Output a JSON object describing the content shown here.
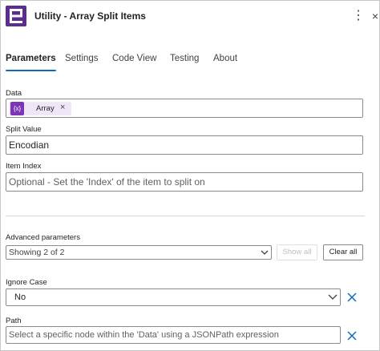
{
  "header": {
    "title": "Utility - Array Split Items",
    "logo_icon": "encodian-logo-icon",
    "more_icon": "more-vertical-icon",
    "close_icon": "close-icon",
    "more_glyph": "⋮",
    "close_glyph": "×"
  },
  "tabs": [
    "Parameters",
    "Settings",
    "Code View",
    "Testing",
    "About"
  ],
  "active_tab": "Parameters",
  "fields": {
    "data": {
      "label": "Data",
      "token": {
        "icon": "{x}",
        "label": "Array",
        "remove": "×"
      }
    },
    "split_value": {
      "label": "Split Value",
      "value": "Encodian"
    },
    "item_index": {
      "label": "Item Index",
      "placeholder": "Optional - Set the 'Index' of the item to split on"
    }
  },
  "advanced": {
    "label": "Advanced parameters",
    "selected": "Showing 2 of 2",
    "show_all": "Show all",
    "clear_all": "Clear all"
  },
  "ignore_case": {
    "label": "Ignore Case",
    "value": "No"
  },
  "path": {
    "label": "Path",
    "placeholder": "Select a specific node within the 'Data' using a JSONPath expression"
  },
  "colors": {
    "accent": "#0f6cbd",
    "brand": "#5b2d8e",
    "token": "#7b35b5"
  }
}
